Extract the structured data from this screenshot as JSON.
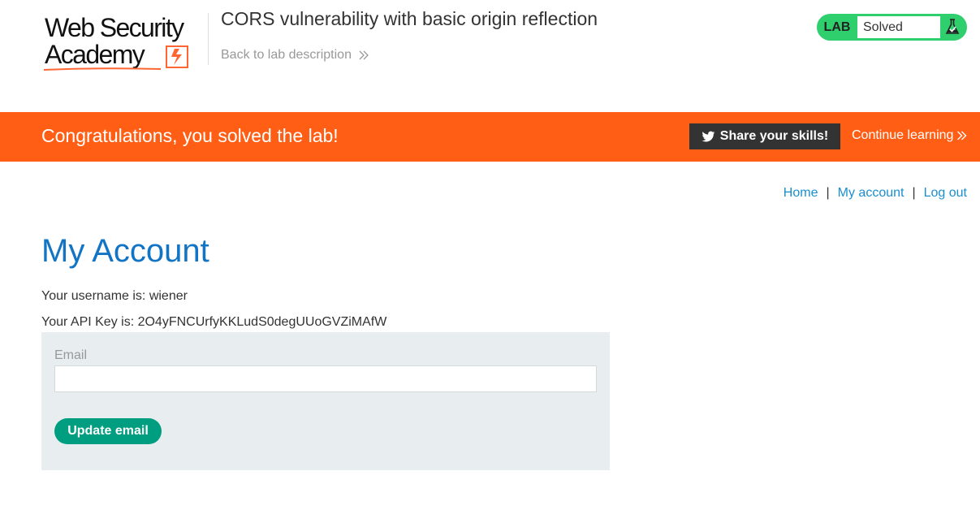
{
  "header": {
    "logo": {
      "line1": "Web Security",
      "line2": "Academy"
    },
    "lab_title": "CORS vulnerability with basic origin reflection",
    "back_link_label": "Back to lab description",
    "lab_status": {
      "badge": "LAB",
      "state": "Solved"
    }
  },
  "banner": {
    "message": "Congratulations, you solved the lab!",
    "share_label": "Share your skills!",
    "continue_label": "Continue learning"
  },
  "nav": {
    "home": "Home",
    "separator": "|",
    "my_account": "My account",
    "log_out": "Log out"
  },
  "account": {
    "heading": "My Account",
    "username_text": "Your username is: wiener",
    "api_key_text": "Your API Key is: 2O4yFNCUrfyKKLudS0degUUoGVZiMAfW"
  },
  "form": {
    "email_label": "Email",
    "email_value": "",
    "update_label": "Update email"
  },
  "colors": {
    "banner_orange": "#ff5e14",
    "solved_green": "#2fcf6e",
    "link_blue": "#1a8fd0",
    "heading_blue": "#1274c4",
    "button_teal": "#009e80",
    "form_bg": "#e8edef"
  },
  "icons": {
    "logo_mark": "lightning-bolt-icon",
    "lab_status": "flask-check-icon",
    "share": "twitter-bird-icon",
    "back_link": "double-chevron-right-icon",
    "continue": "double-chevron-right-icon"
  }
}
